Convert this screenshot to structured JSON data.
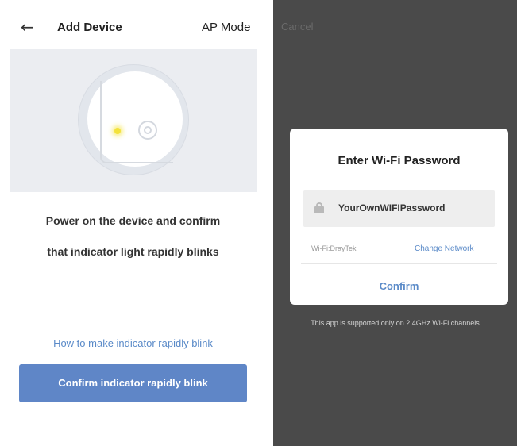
{
  "left_screen": {
    "header": {
      "back_icon": "←",
      "title": "Add Device",
      "mode": "AP Mode"
    },
    "instruction_line1": "Power on the device and confirm",
    "instruction_line2": "that indicator light rapidly blinks",
    "help_link": "How to make indicator rapidly blink",
    "confirm_button": "Confirm indicator rapidly blink",
    "colors": {
      "accent": "#5f86c7",
      "link": "#5a8ac8",
      "indicator_light": "#f3e23a"
    }
  },
  "right_screen": {
    "cancel": "Cancel",
    "dialog": {
      "title": "Enter Wi-Fi Password",
      "password_value": "YourOwnWIFIPassword",
      "network_name": "Wi-Fi:DrayTek",
      "change_network": "Change Network",
      "confirm": "Confirm"
    },
    "support_note": "This app is supported only on 2.4GHz Wi-Fi channels",
    "colors": {
      "overlay": "#4a4a4a",
      "link": "#5a8ac8"
    }
  }
}
